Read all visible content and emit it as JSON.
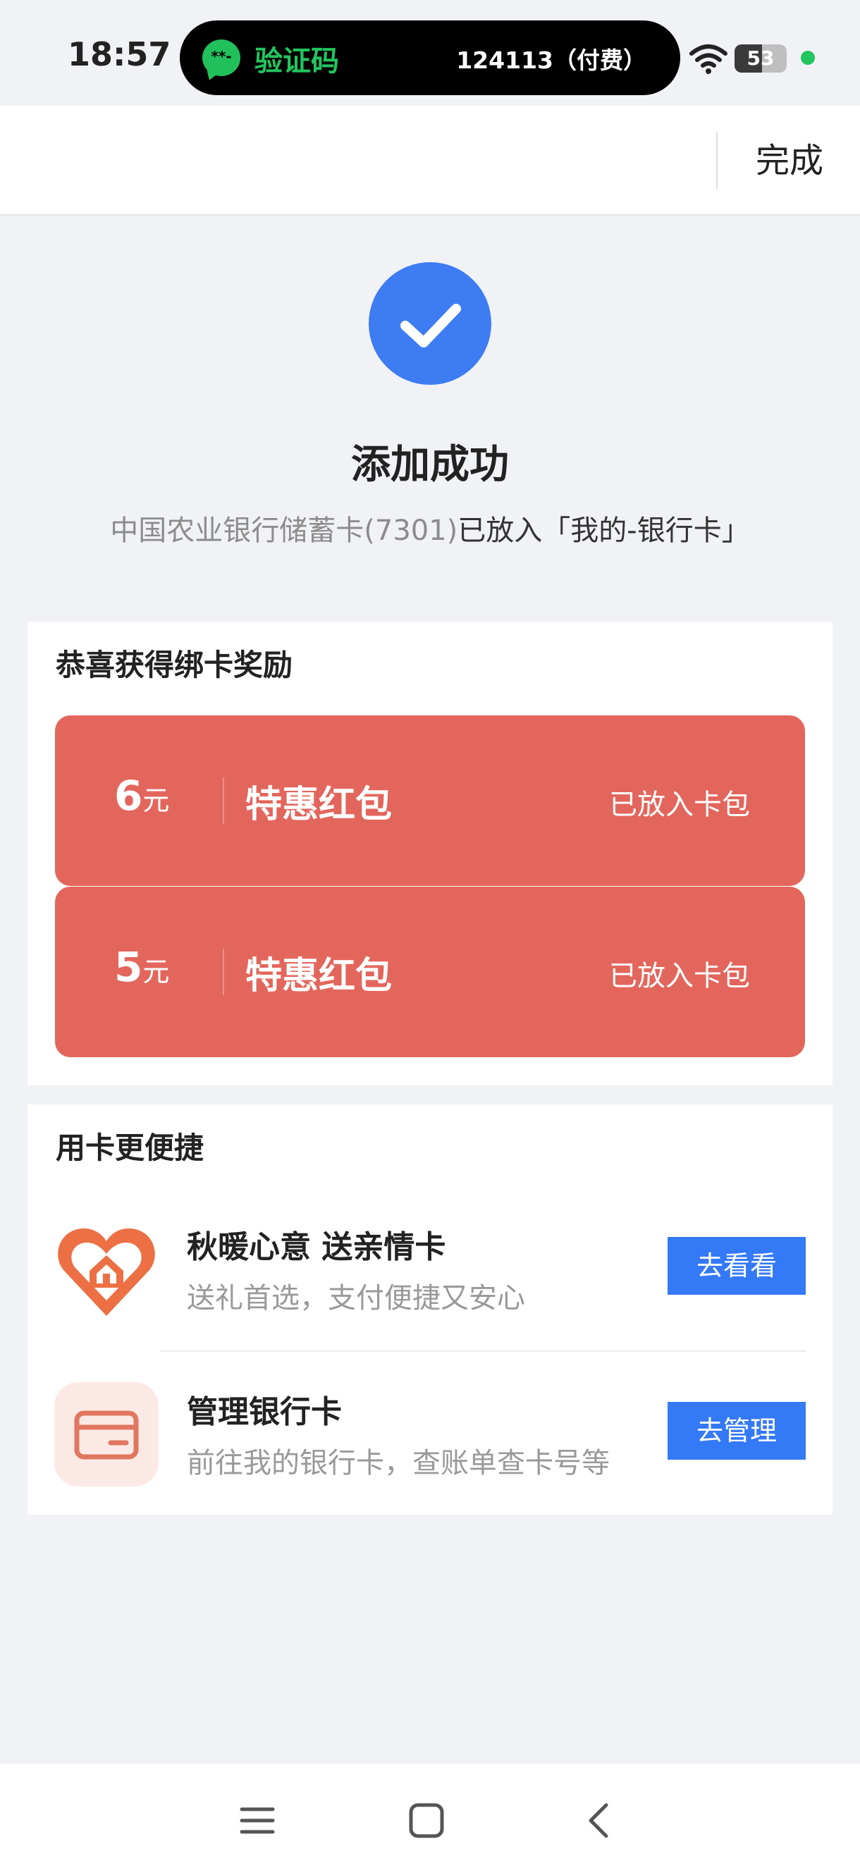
{
  "status_bar": {
    "time": "18:57",
    "notification": {
      "app_icon": "wechat-icon",
      "app_icon_text": "**-",
      "title": "验证码",
      "code": "124113（付费）"
    },
    "battery_level": "53",
    "battery_fraction": 0.53,
    "wifi_icon": "wifi-icon"
  },
  "header": {
    "done_label": "完成"
  },
  "success": {
    "icon": "check-icon",
    "title": "添加成功",
    "card_name": "中国农业银行储蓄卡(7301)",
    "placed_text": "已放入「我的-银行卡」"
  },
  "rewards": {
    "title": "恭喜获得绑卡奖励",
    "coupons": [
      {
        "amount": "6",
        "unit": "元",
        "name": "特惠红包",
        "status": "已放入卡包"
      },
      {
        "amount": "5",
        "unit": "元",
        "name": "特惠红包",
        "status": "已放入卡包"
      }
    ]
  },
  "convenience": {
    "title": "用卡更便捷",
    "items": [
      {
        "icon": "heart-home-icon",
        "title": "秋暖心意 送亲情卡",
        "desc": "送礼首选，支付便捷又安心",
        "button": "去看看"
      },
      {
        "icon": "bank-card-icon",
        "title": "管理银行卡",
        "desc": "前往我的银行卡，查账单查卡号等",
        "button": "去管理"
      }
    ]
  },
  "bottom_nav": {
    "icons": [
      "menu-icon",
      "home-square-icon",
      "back-icon"
    ]
  },
  "colors": {
    "accent": "#3479f6",
    "success": "#3d7cf2",
    "coupon": "#e3665c",
    "background": "#f1f2f6"
  }
}
